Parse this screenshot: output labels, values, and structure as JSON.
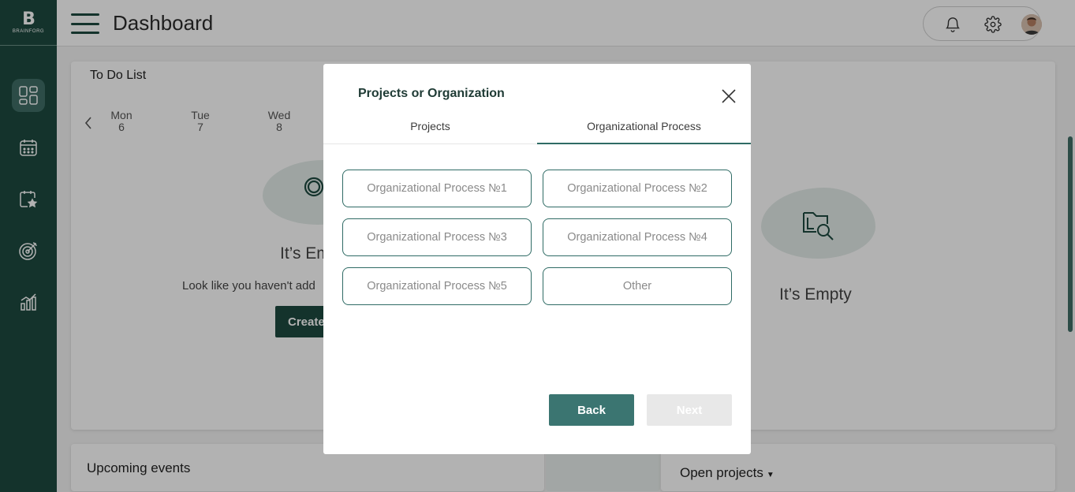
{
  "logo": {
    "mark": "B",
    "word": "BRAINFORG"
  },
  "header": {
    "title": "Dashboard"
  },
  "todo": {
    "title": "To Do List",
    "days": [
      {
        "name": "Mon",
        "num": "6"
      },
      {
        "name": "Tue",
        "num": "7"
      },
      {
        "name": "Wed",
        "num": "8"
      }
    ],
    "empty_title": "It’s Em",
    "empty_sub": "Look like you haven't add",
    "create_label": "Create",
    "right_empty_title": "It’s Empty"
  },
  "events": {
    "title": "Upcoming events"
  },
  "projects": {
    "title": "Open projects"
  },
  "modal": {
    "title": "Projects or Organization",
    "tabs": [
      {
        "label": "Projects",
        "active": false
      },
      {
        "label": "Organizational Process",
        "active": true
      }
    ],
    "options": [
      "Organizational Process №1",
      "Organizational Process №2",
      "Organizational Process №3",
      "Organizational Process №4",
      "Organizational Process №5",
      "Other"
    ],
    "back_label": "Back",
    "next_label": "Next"
  },
  "colors": {
    "brand": "#1d4a40",
    "accent": "#3b7571"
  },
  "icons": [
    "dashboard-icon",
    "calendar-icon",
    "calendar-star-icon",
    "target-icon",
    "chart-icon",
    "bell-icon",
    "gear-icon",
    "close-icon",
    "chevron-left-icon",
    "folder-search-icon",
    "search-icon",
    "hamburger-icon"
  ]
}
